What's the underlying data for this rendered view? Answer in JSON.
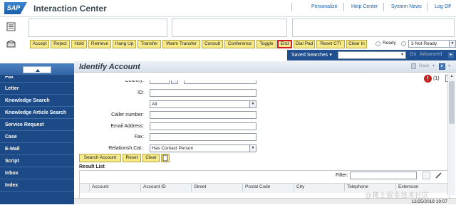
{
  "header": {
    "logo_text": "SAP",
    "title": "Interaction Center",
    "links": [
      "Personalize",
      "Help Center",
      "System News",
      "Log Off"
    ]
  },
  "toolbar": {
    "buttons": [
      "Accept",
      "Reject",
      "Hold",
      "Retrieve",
      "Hang Up",
      "Transfer",
      "Warm Transfer",
      "Consult",
      "Conference",
      "Toggle",
      "End",
      "Dial Pad",
      "Reset CTI",
      "Clear In"
    ],
    "active_button": "End",
    "ready_label": "Ready",
    "status_select": "3 Not Ready"
  },
  "saved_searches": {
    "label": "Saved Searches",
    "go": "Go",
    "advanced": "Advanced"
  },
  "nav": {
    "items": [
      "Fax",
      "Letter",
      "Knowledge Search",
      "Knowledge Article Search",
      "Service Request",
      "Case",
      "E-Mail",
      "Script",
      "Inbox",
      "Index"
    ]
  },
  "page": {
    "title": "Identify Account",
    "back_label": "Back",
    "message_count": "(1)"
  },
  "form": {
    "country_label": "Country:",
    "id_label": "ID:",
    "id_value": "",
    "all_select": "All",
    "caller_label": "Caller number:",
    "email_label": "Email Address:",
    "fax_label": "Fax:",
    "relationship_label": "Relationsh.Cat.:",
    "relationship_value": "Has Contact Person"
  },
  "actions": {
    "search": "Search Account",
    "reset": "Reset",
    "clear": "Clear"
  },
  "result_list": {
    "title": "Result List",
    "filter_label": "Filter:",
    "columns": [
      "Account",
      "Account ID",
      "Street",
      "Postal Code",
      "City",
      "Telephone",
      "Extension"
    ]
  },
  "status_bar": {
    "timestamp": "12/25/2018 19:07"
  },
  "watermark": "@稀土掘金技术社区",
  "colors": {
    "nav_bg": "#1c4a86",
    "button_bg": "#f6e98a",
    "active_border": "#d02020",
    "link": "#1f5fa8"
  }
}
